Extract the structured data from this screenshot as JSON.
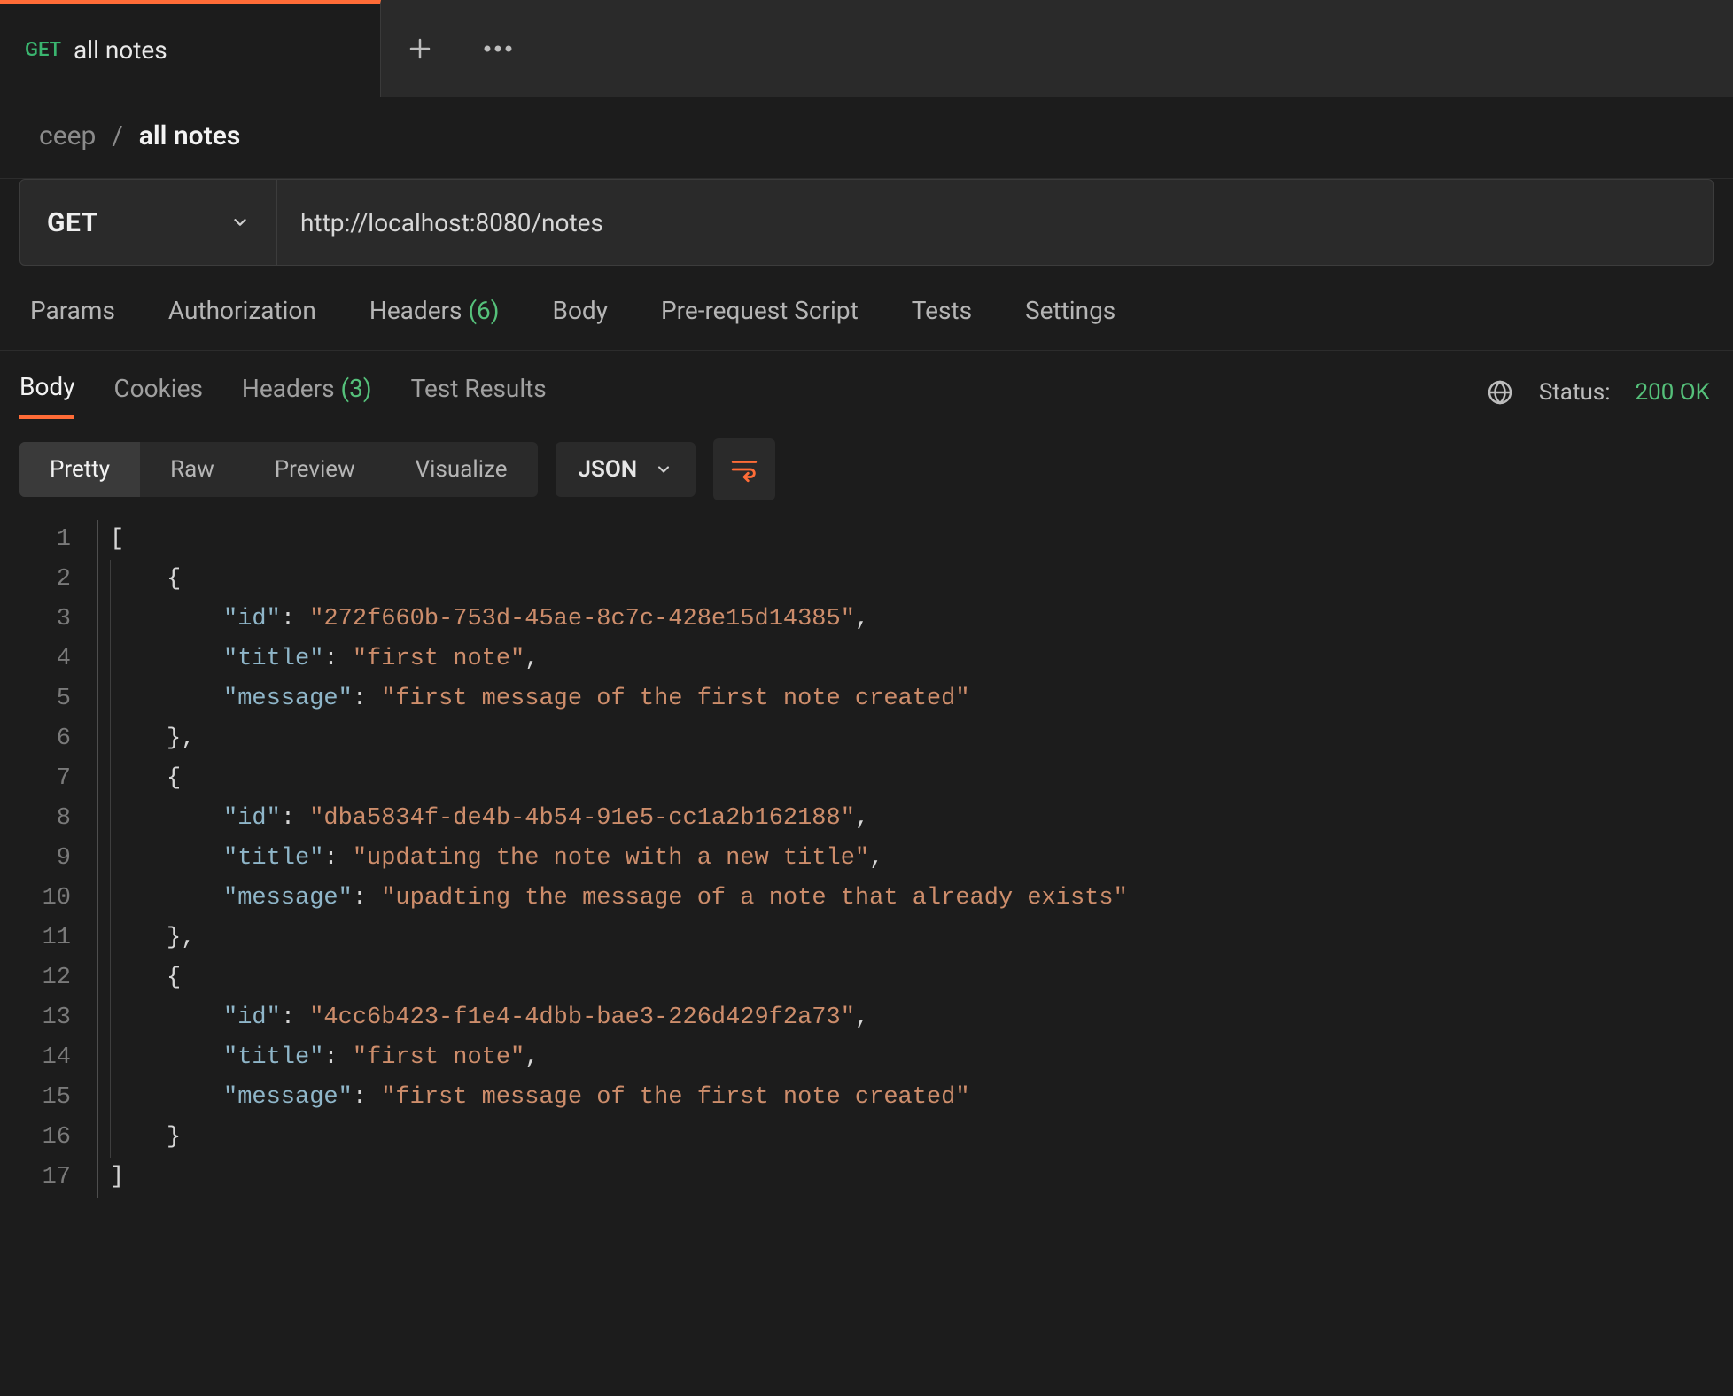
{
  "tab": {
    "method": "GET",
    "title": "all notes"
  },
  "breadcrumb": {
    "collection": "ceep",
    "separator": "/",
    "current": "all notes"
  },
  "request": {
    "method": "GET",
    "url": "http://localhost:8080/notes"
  },
  "config_tabs": {
    "params": "Params",
    "authorization": "Authorization",
    "headers_label": "Headers",
    "headers_count": "(6)",
    "body": "Body",
    "prerequest": "Pre-request Script",
    "tests": "Tests",
    "settings": "Settings"
  },
  "response_tabs": {
    "body": "Body",
    "cookies": "Cookies",
    "headers_label": "Headers",
    "headers_count": "(3)",
    "test_results": "Test Results"
  },
  "status": {
    "label": "Status:",
    "value": "200 OK"
  },
  "view_modes": {
    "pretty": "Pretty",
    "raw": "Raw",
    "preview": "Preview",
    "visualize": "Visualize"
  },
  "format_select": "JSON",
  "response_body": [
    {
      "id": "272f660b-753d-45ae-8c7c-428e15d14385",
      "title": "first note",
      "message": "first message of the first note created"
    },
    {
      "id": "dba5834f-de4b-4b54-91e5-cc1a2b162188",
      "title": "updating the note with a new title",
      "message": "upadting the message of a note that already exists"
    },
    {
      "id": "4cc6b423-f1e4-4dbb-bae3-226d429f2a73",
      "title": "first note",
      "message": "first message of the first note created"
    }
  ]
}
